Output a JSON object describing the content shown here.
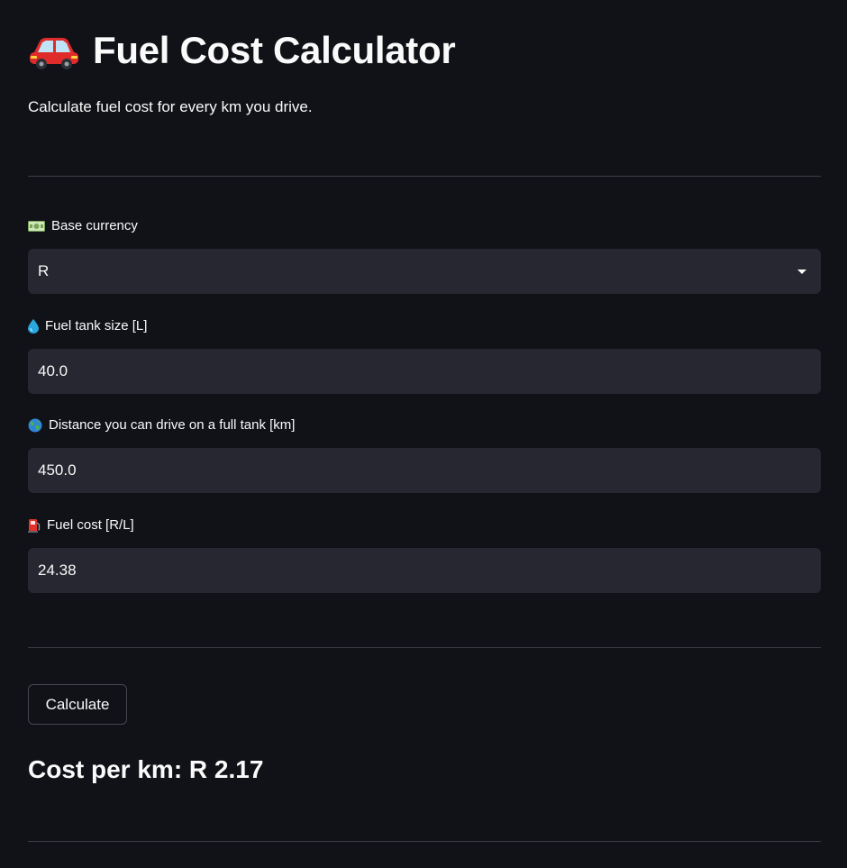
{
  "app": {
    "title": "Fuel Cost Calculator",
    "subtitle": "Calculate fuel cost for every km you drive."
  },
  "fields": {
    "currency": {
      "label": "Base currency",
      "selected": "R",
      "icon": "money-icon"
    },
    "tank": {
      "label": "Fuel tank size [L]",
      "value": "40.0",
      "icon": "droplet-icon"
    },
    "distance": {
      "label": "Distance you can drive on a full tank [km]",
      "value": "450.0",
      "icon": "globe-icon"
    },
    "fuel_cost": {
      "label": "Fuel cost [R/L]",
      "value": "24.38",
      "icon": "fuel-pump-icon"
    }
  },
  "actions": {
    "calculate_label": "Calculate"
  },
  "result": {
    "text": "Cost per km: R 2.17"
  },
  "colors": {
    "background": "#111218",
    "input_background": "#262730",
    "divider": "#3b3d45",
    "text": "#fafafa"
  }
}
